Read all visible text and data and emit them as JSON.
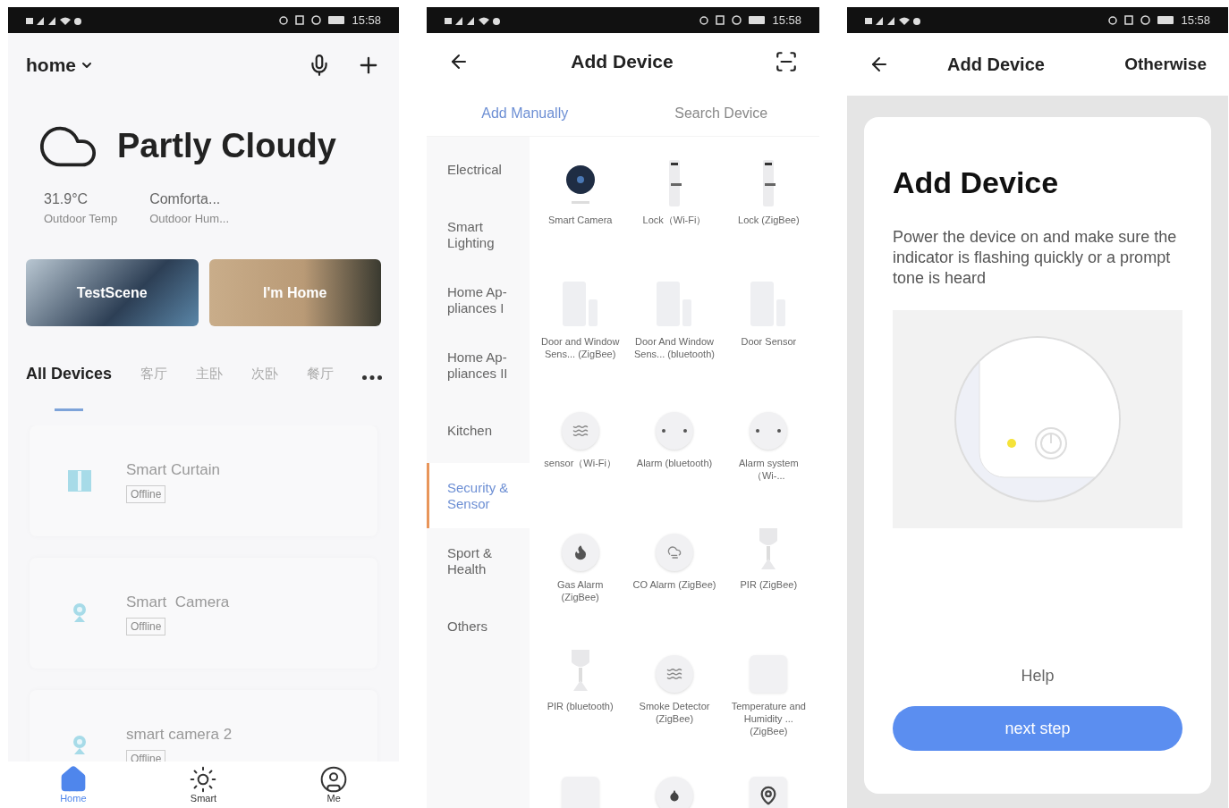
{
  "home_screen": {
    "status_bar": {
      "time": "15:58"
    },
    "home_selector": "home",
    "weather": {
      "condition": "Partly Cloudy",
      "stats": [
        {
          "value": "31.9°C",
          "label": "Outdoor Temp"
        },
        {
          "value": "Comforta...",
          "label": "Outdoor Hum..."
        }
      ]
    },
    "scenes": [
      {
        "name": "TestScene",
        "kind": "house"
      },
      {
        "name": "I'm Home",
        "kind": "tree"
      }
    ],
    "room_tabs": [
      {
        "label": "All Devices",
        "selected": true
      },
      {
        "label": "客厅",
        "selected": false
      },
      {
        "label": "主卧",
        "selected": false
      },
      {
        "label": "次卧",
        "selected": false
      },
      {
        "label": "餐厅",
        "selected": false
      }
    ],
    "devices": [
      {
        "name": "Smart Curtain",
        "status": "Offline",
        "kind": "curtain"
      },
      {
        "name": "Smart  Camera",
        "status": "Offline",
        "kind": "camera"
      },
      {
        "name": "smart camera 2",
        "status": "Offline",
        "kind": "camera"
      }
    ],
    "nav": [
      {
        "label": "Home",
        "kind": "home",
        "selected": true
      },
      {
        "label": "Smart",
        "kind": "sun",
        "selected": false
      },
      {
        "label": "Me",
        "kind": "person",
        "selected": false
      }
    ]
  },
  "add_device_screen": {
    "status_bar": {
      "time": "15:58"
    },
    "title": "Add Device",
    "tabs": [
      {
        "label": "Add Manually",
        "selected": true
      },
      {
        "label": "Search Device",
        "selected": false
      }
    ],
    "categories": [
      {
        "label": "Electrical",
        "selected": false
      },
      {
        "label": "Smart Lighting",
        "selected": false
      },
      {
        "label": "Home Ap-pliances I",
        "selected": false
      },
      {
        "label": "Home Ap-pliances II",
        "selected": false
      },
      {
        "label": "Kitchen",
        "selected": false
      },
      {
        "label": "Security & Sensor",
        "selected": true
      },
      {
        "label": "Sport & Health",
        "selected": false
      },
      {
        "label": "Others",
        "selected": false
      }
    ],
    "device_types": [
      {
        "name": "Smart Camera",
        "kind": "camera"
      },
      {
        "name": "Lock（Wi-Fi）",
        "kind": "lock"
      },
      {
        "name": "Lock (ZigBee)",
        "kind": "lock"
      },
      {
        "name": "Door and Window Sens... (ZigBee)",
        "kind": "door"
      },
      {
        "name": "Door And Window Sens... (bluetooth)",
        "kind": "door"
      },
      {
        "name": "Door Sensor",
        "kind": "door"
      },
      {
        "name": "sensor（Wi-Fi）",
        "kind": "waves"
      },
      {
        "name": "Alarm (bluetooth)",
        "kind": "alarm"
      },
      {
        "name": "Alarm system（Wi-...",
        "kind": "alarm"
      },
      {
        "name": "Gas Alarm (ZigBee)",
        "kind": "flame"
      },
      {
        "name": "CO Alarm (ZigBee)",
        "kind": "cloud"
      },
      {
        "name": "PIR (ZigBee)",
        "kind": "pir"
      },
      {
        "name": "PIR (bluetooth)",
        "kind": "pir"
      },
      {
        "name": "Smoke Detector (ZigBee)",
        "kind": "waves"
      },
      {
        "name": "Temperature and Humidity ... (ZigBee)",
        "kind": "square"
      },
      {
        "kind": "square"
      },
      {
        "kind": "drop"
      },
      {
        "kind": "pin"
      }
    ]
  },
  "instructions_screen": {
    "status_bar": {
      "time": "15:58"
    },
    "title": "Add Device",
    "action": "Otherwise",
    "card": {
      "heading": "Add Device",
      "text": "Power the device on and make sure the indicator is flashing quickly or a prompt tone is heard",
      "help": "Help",
      "button": "next step"
    }
  }
}
